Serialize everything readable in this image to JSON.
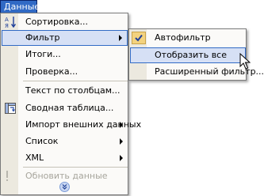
{
  "menubar": {
    "title": "Данные"
  },
  "menu": {
    "items": [
      {
        "label": "Сортировка..."
      },
      {
        "label": "Фильтр"
      },
      {
        "label": "Итоги..."
      },
      {
        "label": "Проверка..."
      },
      {
        "label": "Текст по столбцам..."
      },
      {
        "label": "Сводная таблица..."
      },
      {
        "label": "Импорт внешних данных"
      },
      {
        "label": "Список"
      },
      {
        "label": "XML"
      },
      {
        "label": "Обновить данные"
      }
    ]
  },
  "submenu": {
    "items": [
      {
        "label": "Автофильтр",
        "checked": true
      },
      {
        "label": "Отобразить все"
      },
      {
        "label": "Расширенный фильтр..."
      }
    ]
  },
  "colors": {
    "highlight": "#316ac5",
    "hover_fill": "#d6e0f5",
    "gutter": "#ece9df",
    "disabled_text": "#a7a59c"
  }
}
